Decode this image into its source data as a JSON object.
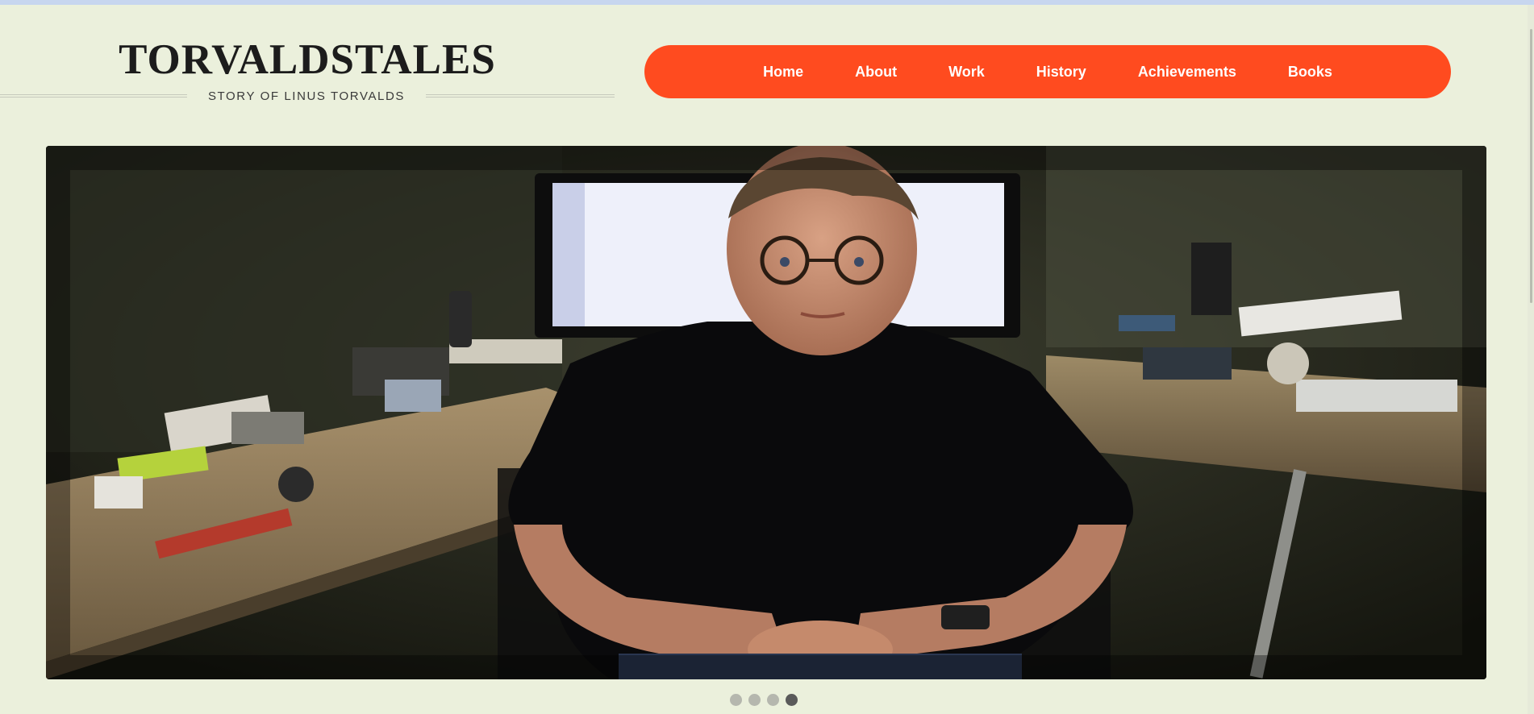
{
  "brand": {
    "title": "TORVALDSTALES",
    "tagline": "STORY OF LINUS TORVALDS"
  },
  "nav": {
    "items": [
      {
        "label": "Home"
      },
      {
        "label": "About"
      },
      {
        "label": "Work"
      },
      {
        "label": "History"
      },
      {
        "label": "Achievements"
      },
      {
        "label": "Books"
      }
    ]
  },
  "slider": {
    "slide_count": 4,
    "active_index": 3
  },
  "colors": {
    "background": "#ebf0dc",
    "nav_accent": "#ff4b1f",
    "title_text": "#1c1c1c"
  }
}
